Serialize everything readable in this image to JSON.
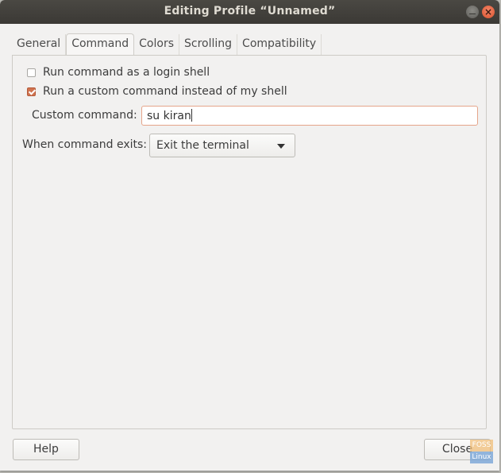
{
  "window": {
    "title": "Editing Profile “Unnamed”",
    "controls": {
      "minimize": "minimize",
      "close": "×"
    }
  },
  "tabs": [
    {
      "label": "General",
      "active": false
    },
    {
      "label": "Command",
      "active": true
    },
    {
      "label": "Colors",
      "active": false
    },
    {
      "label": "Scrolling",
      "active": false
    },
    {
      "label": "Compatibility",
      "active": false
    }
  ],
  "command": {
    "login_shell": {
      "label": "Run command as a login shell",
      "checked": false
    },
    "custom_command_toggle": {
      "label": "Run a custom command instead of my shell",
      "checked": true
    },
    "custom_command": {
      "label": "Custom command:",
      "value": "su kiran"
    },
    "when_exits": {
      "label": "When command exits:",
      "selected": "Exit the terminal"
    }
  },
  "footer": {
    "help_label": "Help",
    "close_label": "Close"
  },
  "watermark": {
    "top": "FOSS",
    "bottom": "Linux"
  },
  "colors": {
    "accent": "#d0734f",
    "titlebar": "#3b3935"
  }
}
